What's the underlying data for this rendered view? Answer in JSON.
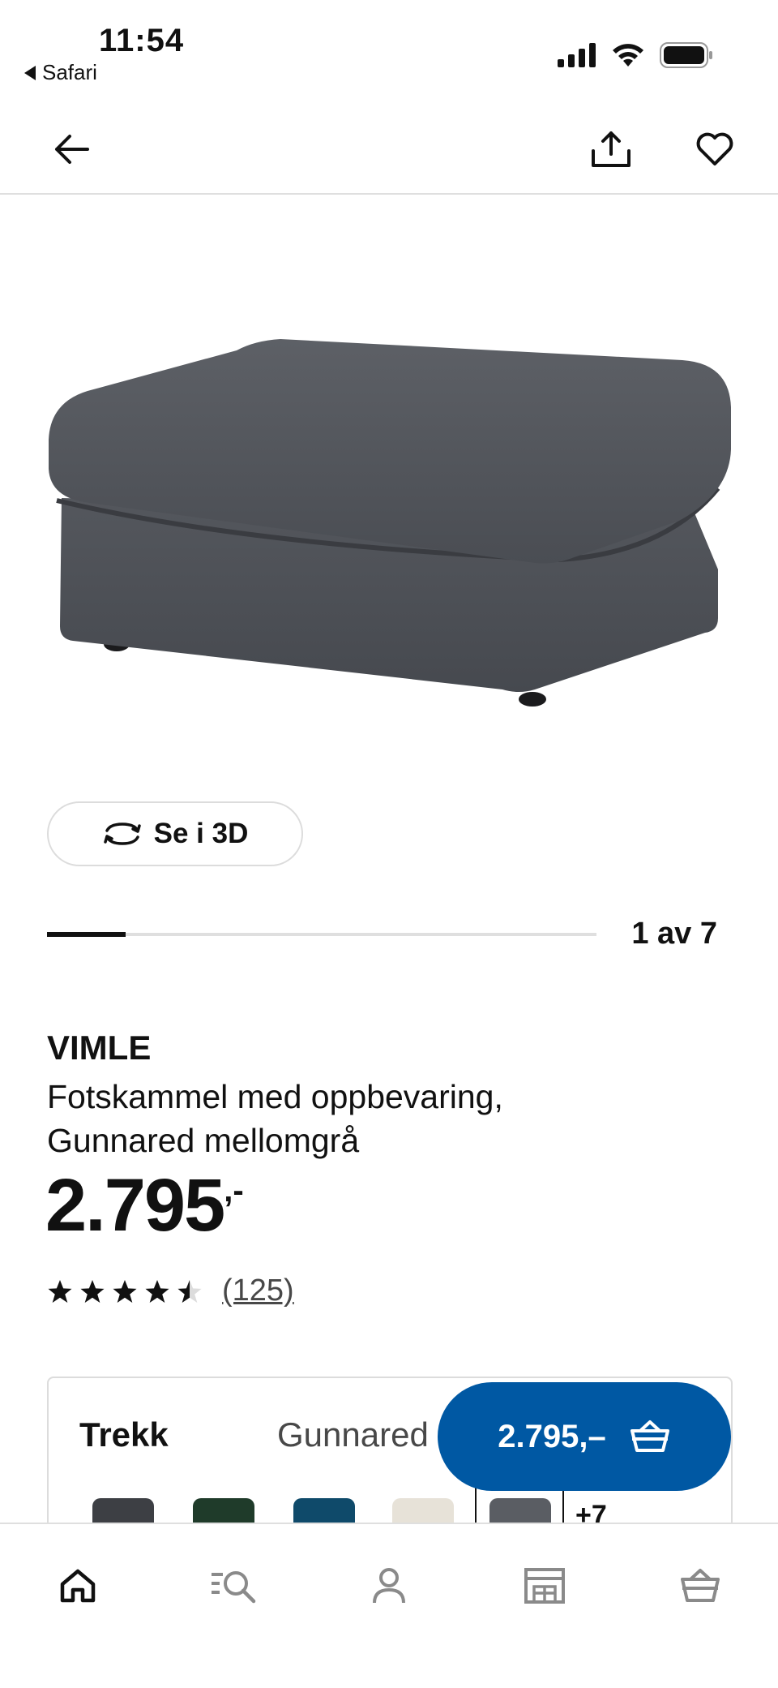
{
  "status_bar": {
    "time": "11:54",
    "back_app": "Safari",
    "icons": [
      "cellular-signal-icon",
      "wifi-icon",
      "battery-icon"
    ]
  },
  "top_nav": {
    "icons": [
      "back-arrow-icon",
      "share-icon",
      "heart-icon"
    ]
  },
  "gallery": {
    "view_3d_label": "Se i 3D",
    "view_3d_icon": "rotate-3d-icon",
    "page_indicator": "1 av 7",
    "current_index": 1,
    "total": 7
  },
  "product": {
    "name": "VIMLE",
    "description_line1": "Fotskammel med oppbevaring,",
    "description_line2": "Gunnared mellomgrå",
    "price": "2.795",
    "price_suffix": ",-",
    "rating": 4.5,
    "rating_max": 5,
    "review_count": "(125)"
  },
  "variant": {
    "label": "Trekk",
    "value": "Gunnared mellomgrå",
    "swatch_colors": [
      "#3d3f44",
      "#1f3b2a",
      "#0f4a6a",
      "#e7e2d8",
      "#5a5d63"
    ],
    "more_count": "+7"
  },
  "cart_button": {
    "label": "2.795,–",
    "icon": "basket-icon",
    "color": "#0058a3"
  },
  "bottom_nav": {
    "items": [
      "home-icon",
      "search-list-icon",
      "profile-icon",
      "store-icon",
      "cart-icon"
    ]
  }
}
